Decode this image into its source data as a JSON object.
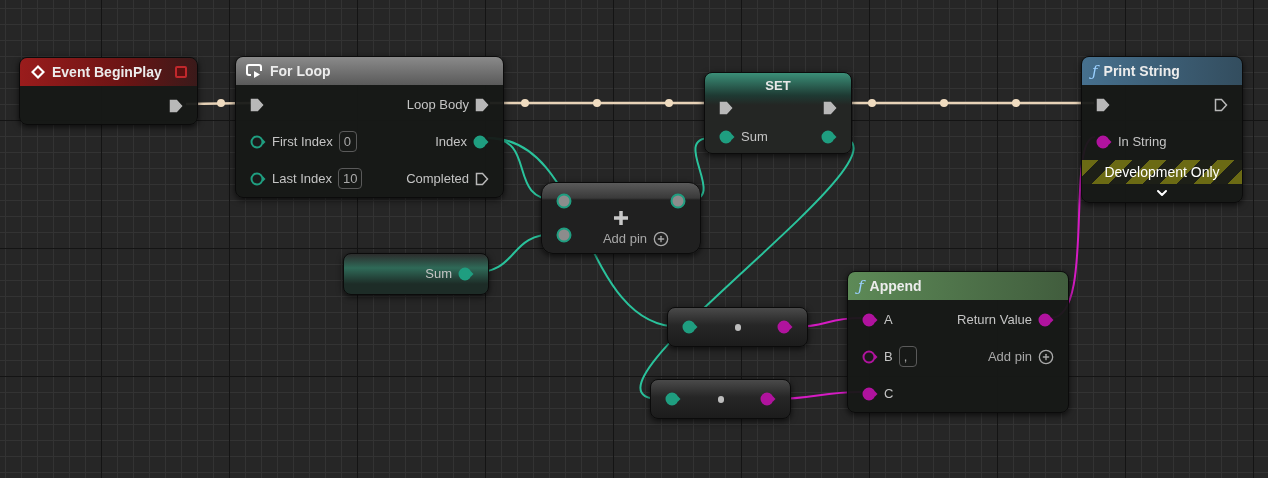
{
  "nodes": [
    {
      "kind": "event",
      "title": "Event BeginPlay",
      "rows": [
        {
          "right": {
            "kind": "exec",
            "connected": true
          }
        }
      ]
    },
    {
      "kind": "macro",
      "title": "For Loop",
      "rows": [
        {
          "left": {
            "kind": "exec",
            "connected": true
          },
          "right": {
            "kind": "exec",
            "connected": true,
            "label": "Loop Body"
          }
        },
        {
          "left": {
            "kind": "int",
            "connected": false,
            "label": "First Index",
            "value": "0"
          },
          "right": {
            "kind": "int",
            "connected": true,
            "label": "Index"
          }
        },
        {
          "left": {
            "kind": "int",
            "connected": false,
            "label": "Last Index",
            "value": "10"
          },
          "right": {
            "kind": "exec",
            "connected": false,
            "label": "Completed"
          }
        }
      ]
    },
    {
      "kind": "variable_set",
      "title": "SET",
      "rows": [
        {
          "left": {
            "kind": "exec",
            "connected": true
          },
          "right": {
            "kind": "exec",
            "connected": true
          }
        },
        {
          "left": {
            "kind": "int",
            "connected": true,
            "label": "Sum"
          },
          "right": {
            "kind": "int",
            "connected": true
          }
        }
      ]
    },
    {
      "kind": "function",
      "icon": "ƒ",
      "title": "Print String",
      "color": "#46708e",
      "rows": [
        {
          "left": {
            "kind": "exec",
            "connected": true
          },
          "right": {
            "kind": "exec",
            "connected": false
          }
        },
        {
          "left": {
            "kind": "string",
            "connected": true,
            "label": "In String"
          }
        }
      ],
      "dev_only": "Development Only",
      "expander": true
    },
    {
      "kind": "math",
      "rows": [
        {
          "left": {
            "kind": "wildcard",
            "connected": true
          },
          "right": {
            "kind": "wildcard",
            "connected": true
          }
        },
        {
          "left": {
            "kind": "wildcard",
            "connected": true
          }
        }
      ],
      "add_pin": "Add pin"
    },
    {
      "kind": "variable_get",
      "rows": [
        {
          "right": {
            "kind": "int",
            "connected": true,
            "label": "Sum"
          }
        }
      ]
    },
    {
      "kind": "function",
      "icon": "ƒ",
      "title": "Append",
      "color": "#5d8a57",
      "rows": [
        {
          "left": {
            "kind": "string",
            "connected": true,
            "label": "A"
          },
          "right": {
            "kind": "string",
            "connected": true,
            "label": "Return Value"
          }
        },
        {
          "left": {
            "kind": "string",
            "connected": false,
            "label": "B",
            "value": ","
          },
          "right": {
            "kind": "add_pin",
            "label": "Add pin"
          }
        },
        {
          "left": {
            "kind": "string",
            "connected": true,
            "label": "C"
          }
        }
      ]
    },
    {
      "kind": "conversion",
      "rows": [
        {
          "left": {
            "kind": "int",
            "connected": true
          },
          "right": {
            "kind": "string",
            "connected": true
          }
        }
      ]
    },
    {
      "kind": "conversion",
      "rows": [
        {
          "left": {
            "kind": "int",
            "connected": true
          },
          "right": {
            "kind": "string",
            "connected": true
          }
        }
      ]
    }
  ]
}
